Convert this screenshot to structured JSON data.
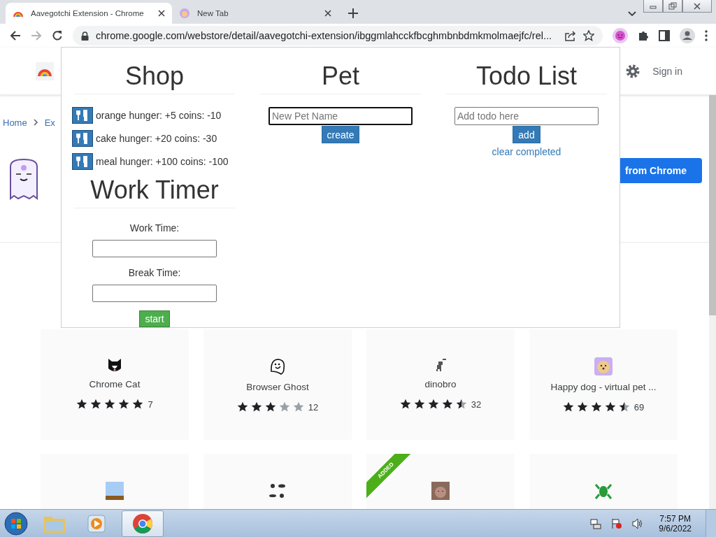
{
  "browser": {
    "tabs": [
      {
        "title": "Aavegotchi Extension - Chrome",
        "selected": true
      },
      {
        "title": "New Tab",
        "selected": false
      }
    ],
    "address": "chrome.google.com/webstore/detail/aavegotchi-extension/ibggmlahcckfbcghmbnbdmkmolmaejfc/rel..."
  },
  "store": {
    "sign_in": "Sign in",
    "breadcrumb": [
      "Home",
      "Ex"
    ],
    "install_button": "from Chrome",
    "cards": [
      {
        "name": "Chrome Cat",
        "stars": 5,
        "count": "7"
      },
      {
        "name": "Browser Ghost",
        "stars": 3,
        "count": "12"
      },
      {
        "name": "dinobro",
        "stars": 4.5,
        "count": "32"
      },
      {
        "name": "Happy dog - virtual pet ...",
        "stars": 4.5,
        "count": "69"
      }
    ],
    "more_cards": [
      {
        "added": false
      },
      {
        "added": false
      },
      {
        "added": true
      },
      {
        "added": false
      }
    ],
    "added_label": "ADDED"
  },
  "popup": {
    "shop": {
      "title": "Shop",
      "items": [
        "orange hunger: +5 coins: -10",
        "cake hunger: +20 coins: -30",
        "meal hunger: +100 coins: -100"
      ]
    },
    "timer": {
      "title": "Work Timer",
      "work_label": "Work Time:",
      "break_label": "Break Time:",
      "button": "start"
    },
    "pet": {
      "title": "Pet",
      "placeholder": "New Pet Name",
      "button": "create"
    },
    "todo": {
      "title": "Todo List",
      "placeholder": "Add todo here",
      "button": "add",
      "link": "clear completed"
    }
  },
  "taskbar": {
    "time": "7:57 PM",
    "date": "9/6/2022"
  }
}
